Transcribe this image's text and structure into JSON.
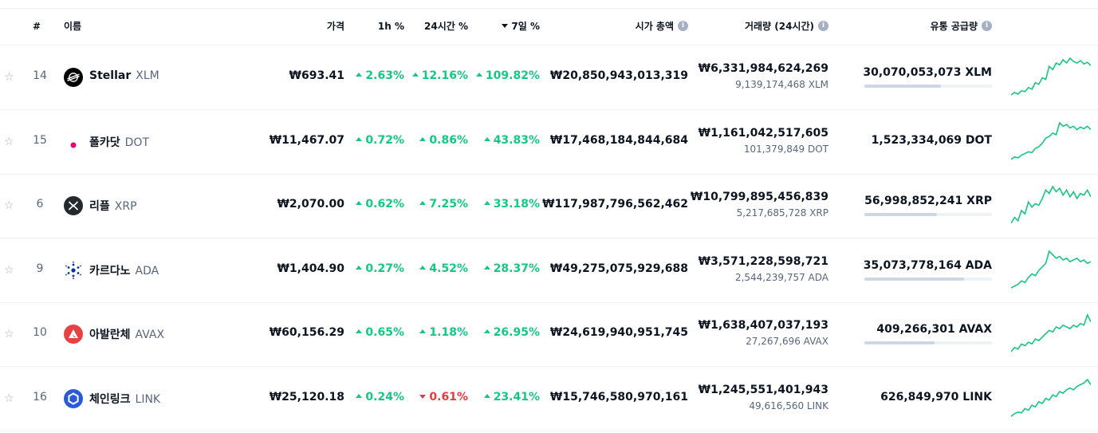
{
  "header": {
    "rank": "#",
    "name": "이름",
    "price": "가격",
    "change_1h": "1h %",
    "change_24h": "24시간 %",
    "change_7d": "7일 %",
    "market_cap": "시가 총액",
    "volume": "거래량 (24시간)",
    "supply": "유통 공급량",
    "info_glyph": "i"
  },
  "colors": {
    "up": "#16c784",
    "down": "#ea3943",
    "sparkline": "#16c784"
  },
  "rows": [
    {
      "rank": "14",
      "name": "Stellar",
      "symbol": "XLM",
      "icon": "stellar-icon",
      "price": "₩693.41",
      "change_1h": "2.63%",
      "change_1h_dir": "up",
      "change_24h": "12.16%",
      "change_24h_dir": "up",
      "change_7d": "109.82%",
      "change_7d_dir": "up",
      "market_cap": "₩20,850,943,013,319",
      "volume": "₩6,331,984,624,269",
      "volume_coin": "9,139,174,468 XLM",
      "supply": "30,070,053,073 XLM",
      "supply_fraction": 0.6,
      "spark": [
        5,
        8,
        6,
        10,
        9,
        14,
        12,
        20,
        18,
        26,
        24,
        40,
        36,
        44,
        42,
        48,
        44,
        50,
        46,
        44,
        47,
        43,
        45,
        41
      ]
    },
    {
      "rank": "15",
      "name": "폴카닷",
      "symbol": "DOT",
      "icon": "polkadot-icon",
      "price": "₩11,467.07",
      "change_1h": "0.72%",
      "change_1h_dir": "up",
      "change_24h": "0.86%",
      "change_24h_dir": "up",
      "change_7d": "43.83%",
      "change_7d_dir": "up",
      "market_cap": "₩17,468,184,844,684",
      "volume": "₩1,161,042,517,605",
      "volume_coin": "101,379,849 DOT",
      "supply": "1,523,334,069 DOT",
      "supply_fraction": null,
      "spark": [
        5,
        8,
        7,
        10,
        12,
        14,
        13,
        18,
        20,
        24,
        30,
        32,
        36,
        34,
        48,
        44,
        46,
        42,
        44,
        40,
        43,
        41,
        44,
        40
      ]
    },
    {
      "rank": "6",
      "name": "리플",
      "symbol": "XRP",
      "icon": "xrp-icon",
      "price": "₩2,070.00",
      "change_1h": "0.62%",
      "change_1h_dir": "up",
      "change_24h": "7.25%",
      "change_24h_dir": "up",
      "change_7d": "33.18%",
      "change_7d_dir": "up",
      "market_cap": "₩117,987,796,562,462",
      "volume": "₩10,799,895,456,839",
      "volume_coin": "5,217,685,728 XRP",
      "supply": "56,998,852,241 XRP",
      "supply_fraction": 0.57,
      "spark": [
        5,
        12,
        8,
        20,
        16,
        30,
        24,
        28,
        26,
        34,
        44,
        40,
        48,
        42,
        46,
        38,
        44,
        36,
        42,
        34,
        40,
        38,
        44,
        36
      ]
    },
    {
      "rank": "9",
      "name": "카르다노",
      "symbol": "ADA",
      "icon": "cardano-icon",
      "price": "₩1,404.90",
      "change_1h": "0.27%",
      "change_1h_dir": "up",
      "change_24h": "4.52%",
      "change_24h_dir": "up",
      "change_7d": "28.37%",
      "change_7d_dir": "up",
      "market_cap": "₩49,275,075,929,688",
      "volume": "₩3,571,228,598,721",
      "volume_coin": "2,544,239,757 ADA",
      "supply": "35,073,778,164 ADA",
      "supply_fraction": 0.78,
      "spark": [
        6,
        8,
        10,
        14,
        12,
        18,
        22,
        20,
        26,
        30,
        34,
        48,
        44,
        40,
        42,
        38,
        40,
        36,
        38,
        40,
        36,
        38,
        34,
        36
      ]
    },
    {
      "rank": "10",
      "name": "아발란체",
      "symbol": "AVAX",
      "icon": "avalanche-icon",
      "price": "₩60,156.29",
      "change_1h": "0.65%",
      "change_1h_dir": "up",
      "change_24h": "1.18%",
      "change_24h_dir": "up",
      "change_7d": "26.95%",
      "change_7d_dir": "up",
      "market_cap": "₩24,619,940,951,745",
      "volume": "₩1,638,407,037,193",
      "volume_coin": "27,267,696 AVAX",
      "supply": "409,266,301 AVAX",
      "supply_fraction": 0.55,
      "spark": [
        5,
        10,
        8,
        14,
        12,
        16,
        14,
        20,
        18,
        22,
        26,
        30,
        28,
        34,
        32,
        36,
        34,
        32,
        36,
        34,
        38,
        36,
        48,
        40
      ]
    },
    {
      "rank": "16",
      "name": "체인링크",
      "symbol": "LINK",
      "icon": "chainlink-icon",
      "price": "₩25,120.18",
      "change_1h": "0.24%",
      "change_1h_dir": "up",
      "change_24h": "0.61%",
      "change_24h_dir": "down",
      "change_7d": "23.41%",
      "change_7d_dir": "up",
      "market_cap": "₩15,746,580,970,161",
      "volume": "₩1,245,551,401,943",
      "volume_coin": "49,616,560 LINK",
      "supply": "626,849,970 LINK",
      "supply_fraction": null,
      "spark": [
        5,
        8,
        10,
        9,
        14,
        12,
        18,
        16,
        22,
        20,
        26,
        24,
        30,
        28,
        34,
        32,
        36,
        38,
        36,
        40,
        42,
        44,
        48,
        42
      ]
    }
  ]
}
